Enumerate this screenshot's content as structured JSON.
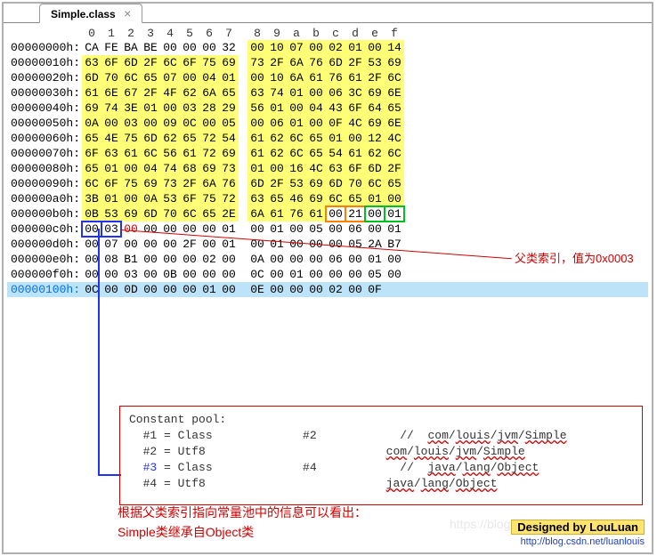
{
  "tab": {
    "title": "Simple.class",
    "close": "×"
  },
  "header": [
    "0",
    "1",
    "2",
    "3",
    "4",
    "5",
    "6",
    "7",
    "8",
    "9",
    "a",
    "b",
    "c",
    "d",
    "e",
    "f"
  ],
  "rows": [
    {
      "addr": "00000000h:",
      "b": [
        "CA",
        "FE",
        "BA",
        "BE",
        "00",
        "00",
        "00",
        "32",
        "00",
        "10",
        "07",
        "00",
        "02",
        "01",
        "00",
        "14"
      ],
      "y": [
        8,
        15
      ]
    },
    {
      "addr": "00000010h:",
      "b": [
        "63",
        "6F",
        "6D",
        "2F",
        "6C",
        "6F",
        "75",
        "69",
        "73",
        "2F",
        "6A",
        "76",
        "6D",
        "2F",
        "53",
        "69"
      ],
      "y": [
        0,
        15
      ]
    },
    {
      "addr": "00000020h:",
      "b": [
        "6D",
        "70",
        "6C",
        "65",
        "07",
        "00",
        "04",
        "01",
        "00",
        "10",
        "6A",
        "61",
        "76",
        "61",
        "2F",
        "6C"
      ],
      "y": [
        0,
        15
      ]
    },
    {
      "addr": "00000030h:",
      "b": [
        "61",
        "6E",
        "67",
        "2F",
        "4F",
        "62",
        "6A",
        "65",
        "63",
        "74",
        "01",
        "00",
        "06",
        "3C",
        "69",
        "6E"
      ],
      "y": [
        0,
        15
      ]
    },
    {
      "addr": "00000040h:",
      "b": [
        "69",
        "74",
        "3E",
        "01",
        "00",
        "03",
        "28",
        "29",
        "56",
        "01",
        "00",
        "04",
        "43",
        "6F",
        "64",
        "65"
      ],
      "y": [
        0,
        15
      ]
    },
    {
      "addr": "00000050h:",
      "b": [
        "0A",
        "00",
        "03",
        "00",
        "09",
        "0C",
        "00",
        "05",
        "00",
        "06",
        "01",
        "00",
        "0F",
        "4C",
        "69",
        "6E"
      ],
      "y": [
        0,
        15
      ]
    },
    {
      "addr": "00000060h:",
      "b": [
        "65",
        "4E",
        "75",
        "6D",
        "62",
        "65",
        "72",
        "54",
        "61",
        "62",
        "6C",
        "65",
        "01",
        "00",
        "12",
        "4C"
      ],
      "y": [
        0,
        15
      ]
    },
    {
      "addr": "00000070h:",
      "b": [
        "6F",
        "63",
        "61",
        "6C",
        "56",
        "61",
        "72",
        "69",
        "61",
        "62",
        "6C",
        "65",
        "54",
        "61",
        "62",
        "6C"
      ],
      "y": [
        0,
        15
      ]
    },
    {
      "addr": "00000080h:",
      "b": [
        "65",
        "01",
        "00",
        "04",
        "74",
        "68",
        "69",
        "73",
        "01",
        "00",
        "16",
        "4C",
        "63",
        "6F",
        "6D",
        "2F"
      ],
      "y": [
        0,
        15
      ]
    },
    {
      "addr": "00000090h:",
      "b": [
        "6C",
        "6F",
        "75",
        "69",
        "73",
        "2F",
        "6A",
        "76",
        "6D",
        "2F",
        "53",
        "69",
        "6D",
        "70",
        "6C",
        "65"
      ],
      "y": [
        0,
        15
      ]
    },
    {
      "addr": "000000a0h:",
      "b": [
        "3B",
        "01",
        "00",
        "0A",
        "53",
        "6F",
        "75",
        "72",
        "63",
        "65",
        "46",
        "69",
        "6C",
        "65",
        "01",
        "00"
      ],
      "y": [
        0,
        15
      ]
    },
    {
      "addr": "000000b0h:",
      "b": [
        "0B",
        "53",
        "69",
        "6D",
        "70",
        "6C",
        "65",
        "2E",
        "6A",
        "61",
        "76",
        "61",
        "00",
        "21",
        "00",
        "01"
      ],
      "y": [
        0,
        11
      ]
    },
    {
      "addr": "000000c0h:",
      "b": [
        "00",
        "03",
        "00",
        "00",
        "00",
        "00",
        "00",
        "01",
        "00",
        "01",
        "00",
        "05",
        "00",
        "06",
        "00",
        "01"
      ]
    },
    {
      "addr": "000000d0h:",
      "b": [
        "00",
        "07",
        "00",
        "00",
        "00",
        "2F",
        "00",
        "01",
        "00",
        "01",
        "00",
        "00",
        "00",
        "05",
        "2A",
        "B7"
      ]
    },
    {
      "addr": "000000e0h:",
      "b": [
        "00",
        "08",
        "B1",
        "00",
        "00",
        "00",
        "02",
        "00",
        "0A",
        "00",
        "00",
        "00",
        "06",
        "00",
        "01",
        "00"
      ]
    },
    {
      "addr": "000000f0h:",
      "b": [
        "00",
        "00",
        "03",
        "00",
        "0B",
        "00",
        "00",
        "00",
        "0C",
        "00",
        "01",
        "00",
        "00",
        "00",
        "05",
        "00"
      ]
    },
    {
      "addr": "00000100h:",
      "b": [
        "0C",
        "00",
        "0D",
        "00",
        "00",
        "00",
        "01",
        "00",
        "0E",
        "00",
        "00",
        "00",
        "02",
        "00",
        "0F"
      ],
      "blue": true
    }
  ],
  "cp": {
    "title": "Constant pool:",
    "lines": [
      {
        "idx": "#1",
        "eq": " = Class",
        "ref": "#2",
        "cmt": "com/louis/jvm/Simple"
      },
      {
        "idx": "#2",
        "eq": " = Utf8",
        "ref": "",
        "plain": "com/louis/jvm/Simple"
      },
      {
        "idx": "#3",
        "eq": " = Class",
        "ref": "#4",
        "cmt": "java/lang/Object",
        "hl": true
      },
      {
        "idx": "#4",
        "eq": " = Utf8",
        "ref": "",
        "plain": "java/lang/Object"
      }
    ]
  },
  "annot": {
    "parent": "父类索引，值为0x0003"
  },
  "summary": {
    "l1": "根据父类索引指向常量池中的信息可以看出：",
    "l2": "Simple类继承自Object类"
  },
  "sig": {
    "main": "Designed by LouLuan",
    "url": "http://blog.csdn.net/luanlouis"
  },
  "watermark": "https://blog.csdn.net/u012501054"
}
